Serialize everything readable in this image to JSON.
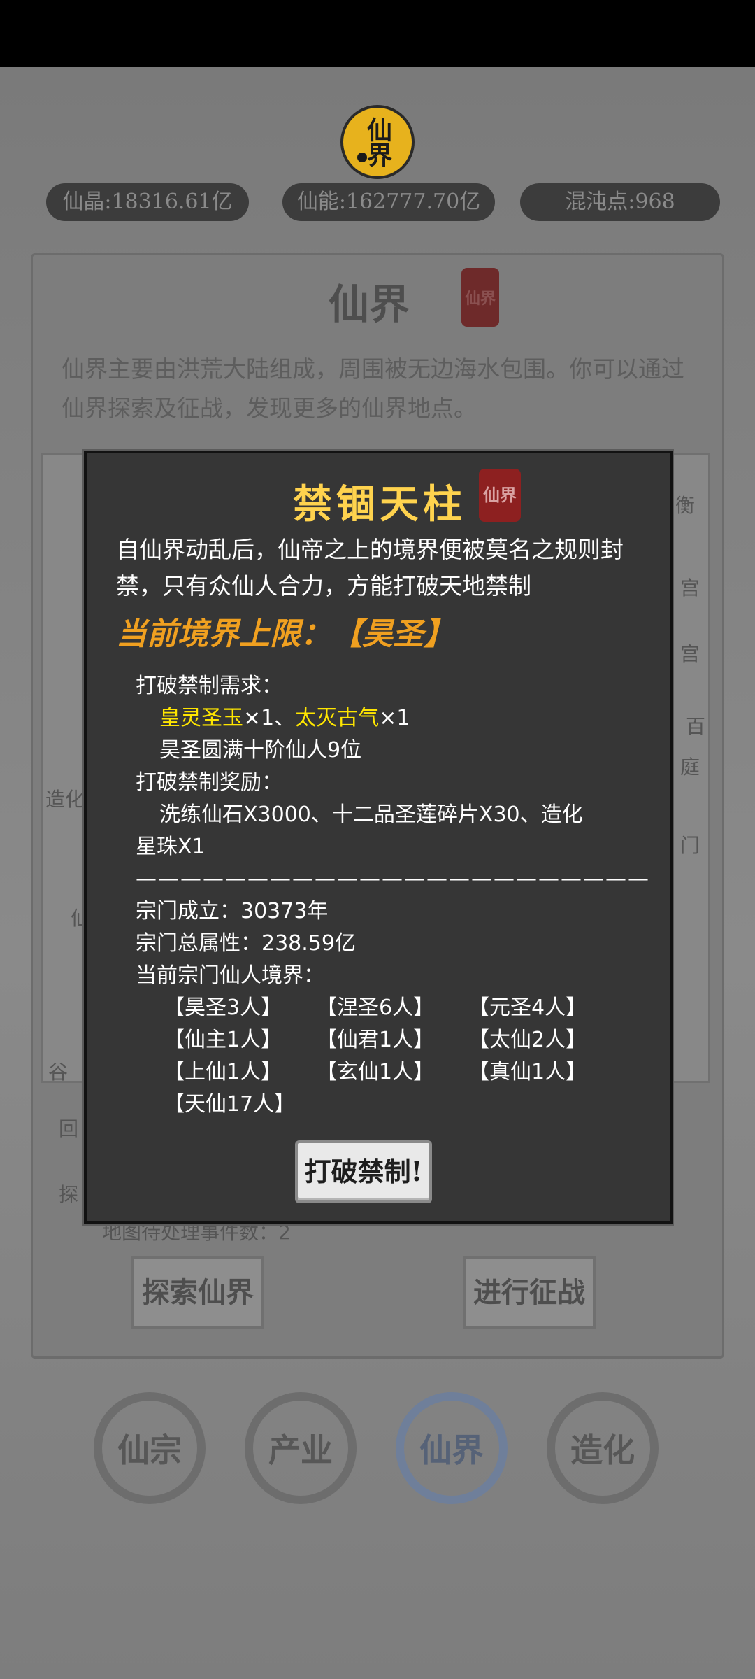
{
  "header": {
    "logo_text": "仙界",
    "resources": [
      {
        "label": "仙晶:18316.61亿"
      },
      {
        "label": "仙能:162777.70亿"
      },
      {
        "label": "混沌点:968"
      }
    ]
  },
  "panel": {
    "title": "仙界",
    "seal": "仙界",
    "description": "仙界主要由洪荒大陆组成，周围被无边海水包围。你可以通过仙界探索及征战，发现更多的仙界地点。",
    "map_fragments": [
      "造化",
      "仙",
      "谷",
      "宫",
      "宫",
      "百",
      "庭",
      "门",
      "衡",
      "回",
      "探"
    ],
    "pending_events": "地图待处理事件数：2",
    "explore_button": "探索仙界",
    "battle_button": "进行征战"
  },
  "bottom_nav": [
    {
      "label": "仙宗"
    },
    {
      "label": "产业"
    },
    {
      "label": "仙界"
    },
    {
      "label": "造化"
    }
  ],
  "modal": {
    "title": "禁锢天柱",
    "seal": "仙界",
    "description": "自仙界动乱后，仙帝之上的境界便被莫名之规则封禁，只有众仙人合力，方能打破天地禁制",
    "limit_label": "当前境界上限：【昊圣】",
    "requirements_title": "打破禁制需求：",
    "req_item1": "皇灵圣玉",
    "req_item1_count": "×1、",
    "req_item2": "太灭古气",
    "req_item2_count": "×1",
    "req_people": "昊圣圆满十阶仙人9位",
    "rewards_title": "打破禁制奖励：",
    "rewards": "洗练仙石X3000、十二品圣莲碎片X30、造化",
    "rewards_cont": "星珠X1",
    "divider": "———————————————————————",
    "sect_founded": "宗门成立：30373年",
    "sect_attr": "宗门总属性：238.59亿",
    "realms_title": "当前宗门仙人境界：",
    "realms": [
      "【昊圣3人】",
      "【涅圣6人】",
      "【元圣4人】",
      "【仙主1人】",
      "【仙君1人】",
      "【太仙2人】",
      "【上仙1人】",
      "【玄仙1人】",
      "【真仙1人】",
      "【天仙17人】"
    ],
    "break_button": "打破禁制!"
  },
  "colors": {
    "gold": "#ffd34e",
    "highlight": "#ffe600",
    "limit": "#f0a020",
    "seal": "#8d2020"
  }
}
